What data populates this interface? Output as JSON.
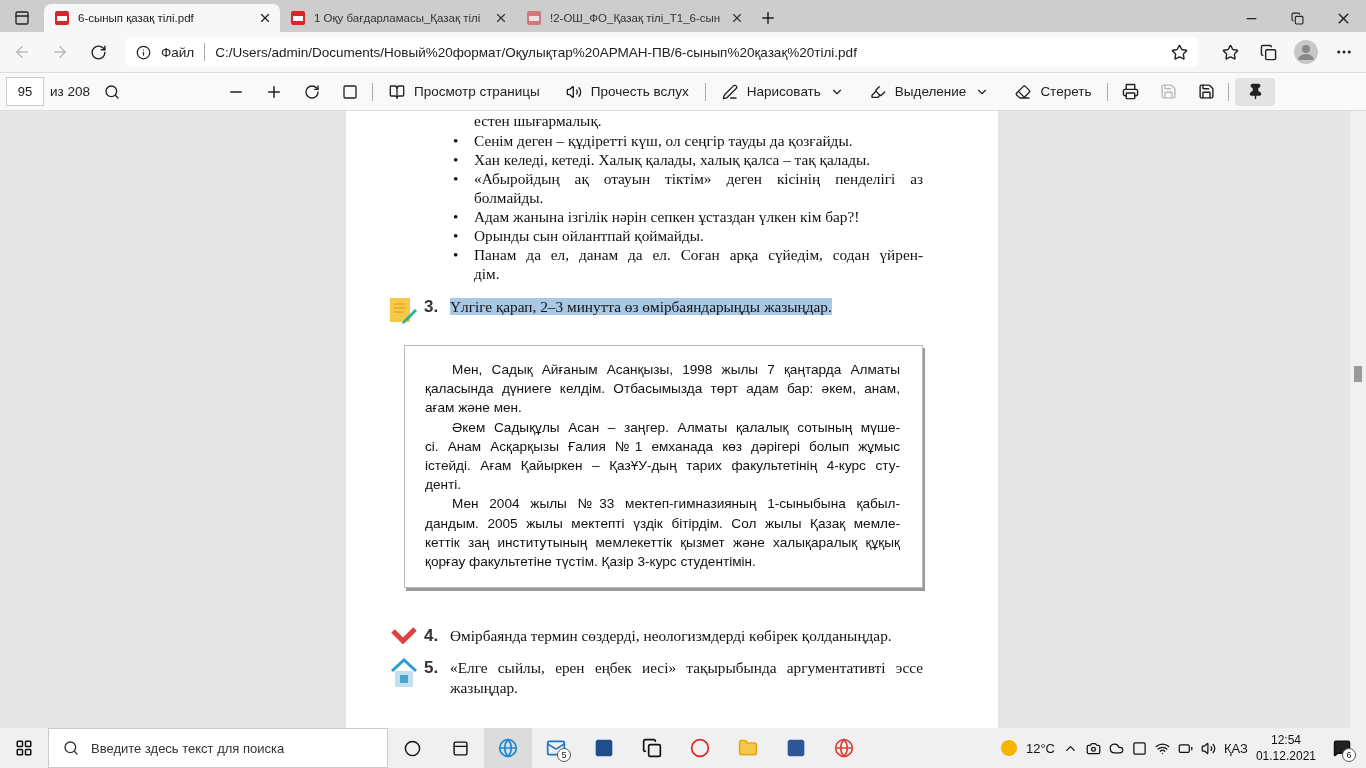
{
  "tabs": [
    {
      "title": "6-сынып қазақ тілі.pdf",
      "selected": true
    },
    {
      "title": "1 Оқу бағдарламасы_Қазақ тілі",
      "selected": false
    },
    {
      "title": "!2-ОШ_ФО_Қазақ тілі_Т1_6-сын",
      "selected": false
    }
  ],
  "address": {
    "scheme": "Файл",
    "url": "C:/Users/admin/Documents/Новый%20формат/Оқулықтар%20АРМАН-ПВ/6-сынып%20қазақ%20тілі.pdf"
  },
  "pdf_toolbar": {
    "page": "95",
    "total": "из 208",
    "items": [
      {
        "kind": "view",
        "label": "Просмотр страницы",
        "dropdown": false
      },
      {
        "kind": "read",
        "label": "Прочесть вслух",
        "dropdown": false
      },
      {
        "kind": "draw",
        "label": "Нарисовать",
        "dropdown": true
      },
      {
        "kind": "highlight",
        "label": "Выделение",
        "dropdown": true
      },
      {
        "kind": "erase",
        "label": "Стереть",
        "dropdown": false
      }
    ],
    "save_disabled": true,
    "pinned": true
  },
  "page": {
    "continuation": [
      "естен шығармалық."
    ],
    "bullets": [
      {
        "marker": "•",
        "lines": [
          "Сенім деген – құдіретті күш, ол сеңгір тауды да қозғайды."
        ]
      },
      {
        "marker": "•",
        "lines": [
          "Хан келеді, кетеді. Халық қалады, халық қалса – тақ қалады."
        ]
      },
      {
        "marker": "•",
        "lines": [
          "«Абыройдың ақ отауын тіктім» деген кісінің пенделігі аз",
          "болмайды."
        ]
      },
      {
        "marker": "•",
        "lines": [
          "Адам жанына ізгілік нәрін сепкен ұстаздан үлкен кім бар?!"
        ]
      },
      {
        "marker": "•",
        "lines": [
          "Орынды сын ойлантпай қоймайды."
        ]
      },
      {
        "marker": "•",
        "lines": [
          "Панам да ел, данам да ел. Соған арқа сүйедім, содан үйрен-",
          "дім."
        ]
      }
    ],
    "tasks": [
      {
        "number": "3.",
        "kind": "notepad",
        "lines": [
          "Үлгіге қарап, 2–3 минутта өз өмірбаяндарыңды жазыңдар."
        ],
        "highlighted": true,
        "sample": [
          [
            "Мен, Садық Айғаным Асанқызы, 1998 жылы 7 қаңтарда Алматы",
            "қаласында дүниеге келдім. Отбасымызда төрт адам бар: әкем, анам,",
            "ағам және мен."
          ],
          [
            "Әкем Садықұлы Асан – заңгер. Алматы қалалық сотының мүше-",
            "сі. Анам Асқарқызы Ғалия №1 емханада көз дәрігері болып жұмыс",
            "істейді. Ағам Қайыркен – ҚазҰУ-дың тарих факультетінің 4-курс сту-",
            "денті."
          ],
          [
            "Мен 2004 жылы №33 мектеп-гимназияның 1-сыныбына қабыл-",
            "дандым. 2005 жылы мектепті үздік бітірдім. Сол жылы Қазақ мемле-",
            "кеттік заң институтының мемлекеттік қызмет және халықаралық құқық",
            "қорғау факультетіне түстім. Қазір 3-курс студентімін."
          ]
        ]
      },
      {
        "number": "4.",
        "kind": "check",
        "lines": [
          "Өмірбаянда термин сөздерді, неологизмдерді көбірек қолданыңдар."
        ],
        "highlighted": false
      },
      {
        "number": "5.",
        "kind": "house",
        "lines": [
          "«Елге сыйлы, ерен еңбек иесі» тақырыбында аргументативті эссе",
          "жазыңдар."
        ],
        "highlighted": false
      }
    ]
  },
  "taskbar": {
    "search_placeholder": "Введите здесь текст для поиска",
    "mail_badge": "5",
    "temperature": "12°C",
    "language": "ҚАЗ",
    "time": "12:54",
    "date": "01.12.2021",
    "notifications": "6"
  }
}
